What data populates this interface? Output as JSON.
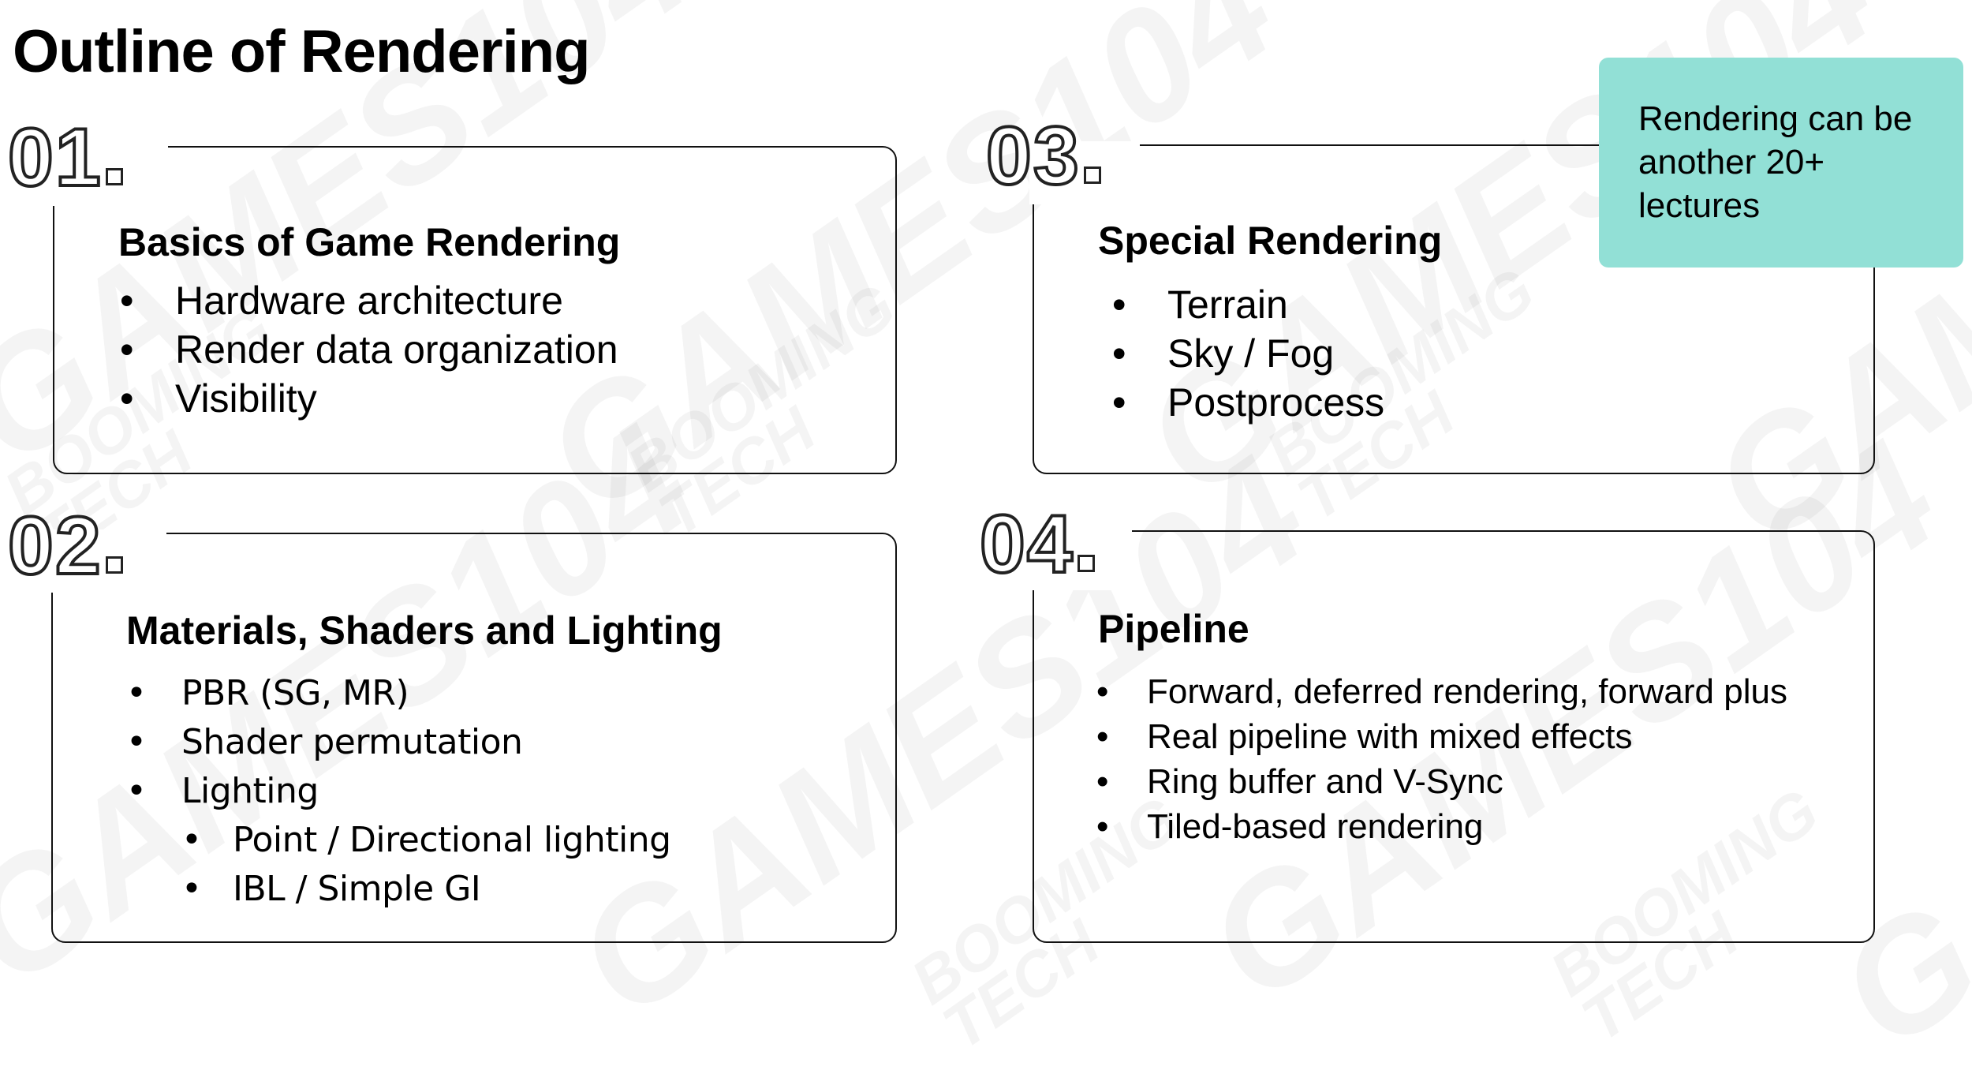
{
  "slide": {
    "title": "Outline of Rendering",
    "watermark": {
      "primary": "GAMES104",
      "secondary_line1": "BOOMING",
      "secondary_line2": "TECH"
    },
    "accent_color": "#92e0d6",
    "sections": [
      {
        "number": "01",
        "title": "Basics of Game Rendering",
        "items": [
          {
            "text": "Hardware architecture"
          },
          {
            "text": "Render data organization"
          },
          {
            "text": "Visibility"
          }
        ]
      },
      {
        "number": "02",
        "title": "Materials, Shaders and Lighting",
        "items": [
          {
            "text": "PBR (SG, MR)"
          },
          {
            "text": "Shader permutation"
          },
          {
            "text": "Lighting"
          },
          {
            "text": "Point / Directional lighting",
            "level": 2
          },
          {
            "text": "IBL / Simple GI",
            "level": 2
          }
        ]
      },
      {
        "number": "03",
        "title": "Special Rendering",
        "items": [
          {
            "text": "Terrain"
          },
          {
            "text": "Sky / Fog"
          },
          {
            "text": "Postprocess"
          }
        ]
      },
      {
        "number": "04",
        "title": "Pipeline",
        "items": [
          {
            "text": "Forward, deferred rendering, forward plus"
          },
          {
            "text": "Real pipeline with mixed effects"
          },
          {
            "text": "Ring buffer and V-Sync"
          },
          {
            "text": "Tiled-based rendering"
          }
        ]
      }
    ],
    "callout": {
      "line1": "Rendering can be",
      "line2": "another 20+",
      "line3": "lectures"
    }
  }
}
